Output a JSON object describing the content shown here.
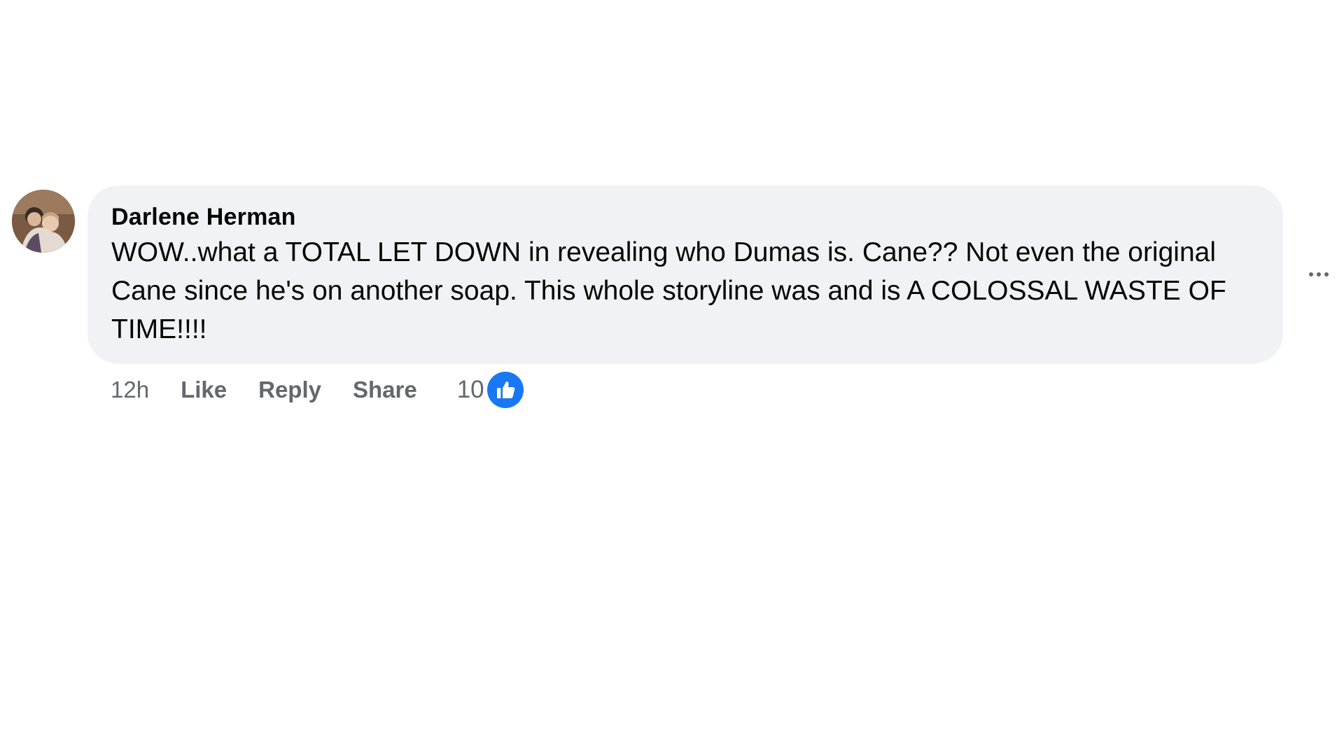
{
  "comment": {
    "author": "Darlene Herman",
    "text": "WOW..what a TOTAL LET DOWN in revealing who Dumas is. Cane?? Not even the original Cane since he's on another soap. This whole storyline was and is A COLOSSAL WASTE OF TIME!!!!",
    "timestamp": "12h",
    "actions": {
      "like": "Like",
      "reply": "Reply",
      "share": "Share"
    },
    "reaction_count": "10",
    "reaction_icon": "thumbs-up-icon",
    "more_icon": "more-options-icon",
    "colors": {
      "bubble": "#f0f2f5",
      "text": "#050505",
      "secondary": "#65676b",
      "like_blue": "#1877f2"
    }
  }
}
